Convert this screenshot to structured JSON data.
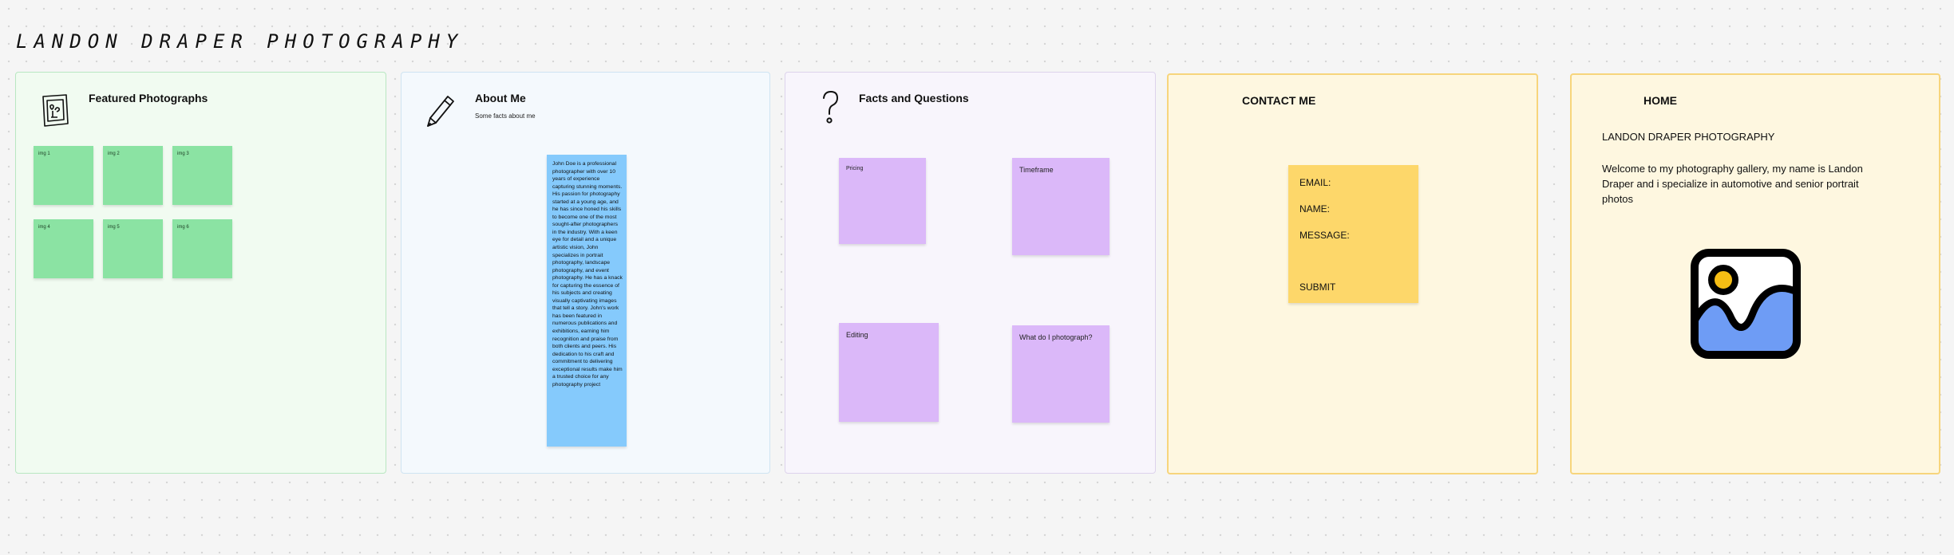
{
  "board": {
    "title": "LANDON DRAPER PHOTOGRAPHY"
  },
  "featured": {
    "title": "Featured Photographs",
    "icon": "framed-picture-icon",
    "images": [
      "img 1",
      "img 2",
      "img 3",
      "img 4",
      "img 5",
      "img 6"
    ]
  },
  "about": {
    "title": "About Me",
    "subtitle": "Some facts about me",
    "icon": "pencil-icon",
    "bio": "John Doe is a professional photographer with over 10 years of experience capturing stunning moments. His passion for photography started at a young age, and he has since honed his skills to become one of the most sought-after photographers in the industry. With a keen eye for detail and a unique artistic vision, John specializes in portrait photography, landscape photography, and event photography. He has a knack for capturing the essence of his subjects and creating visually captivating images that tell a story. John's work has been featured in numerous publications and exhibitions, earning him recognition and praise from both clients and peers. His dedication to his craft and commitment to delivering exceptional results make him a trusted choice for any photography project"
  },
  "facts": {
    "title": "Facts and Questions",
    "icon": "question-mark-icon",
    "notes": {
      "pricing": "Pricing",
      "timeframe": "Timeframe",
      "editing": "Editing",
      "what": "What do I photograph?"
    }
  },
  "contact": {
    "title": "CONTACT ME",
    "email": "EMAIL:",
    "name": "NAME:",
    "message": "MESSAGE:",
    "submit": "SUBMIT"
  },
  "home": {
    "title": "HOME",
    "heading": "LANDON DRAPER PHOTOGRAPHY",
    "welcome": "Welcome to my photography gallery, my name is Landon Draper and i specialize in automotive and senior portrait photos",
    "icon": "image-icon"
  },
  "colors": {
    "green_sticky": "#8be3a3",
    "blue_sticky": "#85cafc",
    "purple_sticky": "#dbb8f9",
    "yellow_sticky": "#fdd76a",
    "image_icon_sun": "#f5bd14",
    "image_icon_mountain": "#6e9cf5"
  }
}
